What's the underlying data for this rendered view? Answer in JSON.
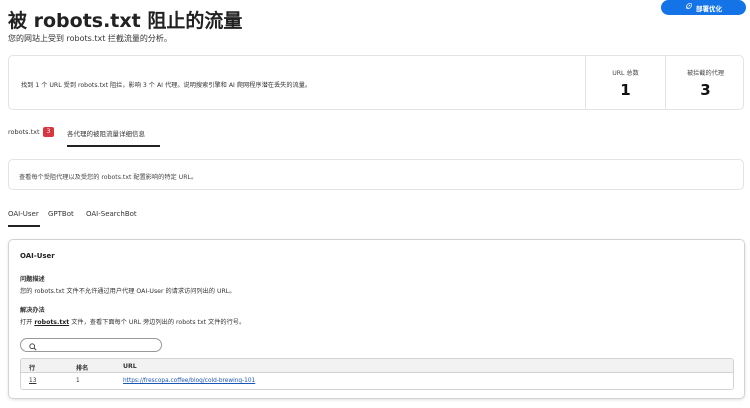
{
  "header": {
    "title": "被 robots.txt 阻止的流量",
    "subtitle": "您的网站上受到 robots.txt 拦截流量的分析。",
    "deploy_label": "部署优化"
  },
  "summary": {
    "text": "找到 1 个 URL 受到 robots.txt 阻拦，影响 3 个 AI 代理。说明搜索引擎和 AI 爬网程序潜在丢失的流量。",
    "stats": [
      {
        "label": "URL 总数",
        "value": "1"
      },
      {
        "label": "被拦截的代理",
        "value": "3"
      }
    ]
  },
  "main_tabs": [
    {
      "label": "robots.txt",
      "badge": "3"
    },
    {
      "label": "各代理的被阻流量详细信息"
    }
  ],
  "info": {
    "text": "查看每个受阻代理以及受您的 robots.txt 配置影响的特定 URL。"
  },
  "agent_tabs": [
    "OAI-User",
    "GPTBot",
    "OAI-SearchBot"
  ],
  "detail": {
    "title": "OAI-User",
    "problem_heading": "问题描述",
    "problem_text": "您的 robots.txt 文件不允许通过用户代理 OAI-User 的请求访问列出的 URL。",
    "solution_heading": "解决办法",
    "solution_prefix": "打开",
    "solution_file": "robots.txt",
    "solution_suffix": "文件，查看下面每个 URL 旁边列出的 robots txt 文件的行号。",
    "search": {
      "placeholder": "",
      "value": ""
    },
    "table": {
      "headers": [
        "行",
        "排名",
        "URL"
      ],
      "rows": [
        {
          "line": "13",
          "rank": "1",
          "url": "https://frescopa.coffee/blog/cold-brewing-101"
        }
      ]
    }
  },
  "colors": {
    "accent": "#1473e6",
    "badge": "#d7373f",
    "link": "#1a55b8"
  }
}
